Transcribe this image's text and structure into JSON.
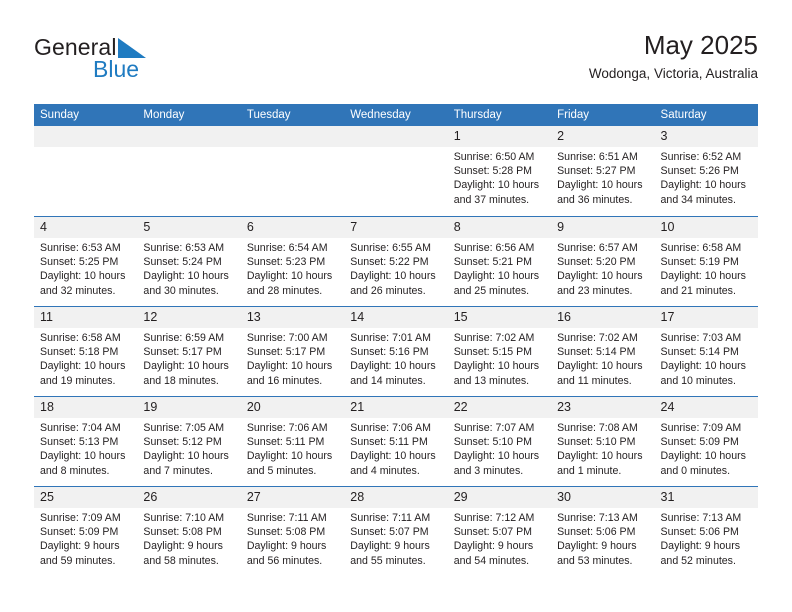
{
  "brand": {
    "name_part1": "General",
    "name_part2": "Blue",
    "triangle_color": "#1f7bc1"
  },
  "header": {
    "title": "May 2025",
    "subtitle": "Wodonga, Victoria, Australia"
  },
  "theme": {
    "header_blue": "#3075b8",
    "day_band_gray": "#f1f1f1",
    "text": "#231f20",
    "brand_blue": "#1f7bc1"
  },
  "weekdays": [
    "Sunday",
    "Monday",
    "Tuesday",
    "Wednesday",
    "Thursday",
    "Friday",
    "Saturday"
  ],
  "weeks": [
    [
      {
        "day": "",
        "lines": []
      },
      {
        "day": "",
        "lines": []
      },
      {
        "day": "",
        "lines": []
      },
      {
        "day": "",
        "lines": []
      },
      {
        "day": "1",
        "lines": [
          "Sunrise: 6:50 AM",
          "Sunset: 5:28 PM",
          "Daylight: 10 hours",
          "and 37 minutes."
        ]
      },
      {
        "day": "2",
        "lines": [
          "Sunrise: 6:51 AM",
          "Sunset: 5:27 PM",
          "Daylight: 10 hours",
          "and 36 minutes."
        ]
      },
      {
        "day": "3",
        "lines": [
          "Sunrise: 6:52 AM",
          "Sunset: 5:26 PM",
          "Daylight: 10 hours",
          "and 34 minutes."
        ]
      }
    ],
    [
      {
        "day": "4",
        "lines": [
          "Sunrise: 6:53 AM",
          "Sunset: 5:25 PM",
          "Daylight: 10 hours",
          "and 32 minutes."
        ]
      },
      {
        "day": "5",
        "lines": [
          "Sunrise: 6:53 AM",
          "Sunset: 5:24 PM",
          "Daylight: 10 hours",
          "and 30 minutes."
        ]
      },
      {
        "day": "6",
        "lines": [
          "Sunrise: 6:54 AM",
          "Sunset: 5:23 PM",
          "Daylight: 10 hours",
          "and 28 minutes."
        ]
      },
      {
        "day": "7",
        "lines": [
          "Sunrise: 6:55 AM",
          "Sunset: 5:22 PM",
          "Daylight: 10 hours",
          "and 26 minutes."
        ]
      },
      {
        "day": "8",
        "lines": [
          "Sunrise: 6:56 AM",
          "Sunset: 5:21 PM",
          "Daylight: 10 hours",
          "and 25 minutes."
        ]
      },
      {
        "day": "9",
        "lines": [
          "Sunrise: 6:57 AM",
          "Sunset: 5:20 PM",
          "Daylight: 10 hours",
          "and 23 minutes."
        ]
      },
      {
        "day": "10",
        "lines": [
          "Sunrise: 6:58 AM",
          "Sunset: 5:19 PM",
          "Daylight: 10 hours",
          "and 21 minutes."
        ]
      }
    ],
    [
      {
        "day": "11",
        "lines": [
          "Sunrise: 6:58 AM",
          "Sunset: 5:18 PM",
          "Daylight: 10 hours",
          "and 19 minutes."
        ]
      },
      {
        "day": "12",
        "lines": [
          "Sunrise: 6:59 AM",
          "Sunset: 5:17 PM",
          "Daylight: 10 hours",
          "and 18 minutes."
        ]
      },
      {
        "day": "13",
        "lines": [
          "Sunrise: 7:00 AM",
          "Sunset: 5:17 PM",
          "Daylight: 10 hours",
          "and 16 minutes."
        ]
      },
      {
        "day": "14",
        "lines": [
          "Sunrise: 7:01 AM",
          "Sunset: 5:16 PM",
          "Daylight: 10 hours",
          "and 14 minutes."
        ]
      },
      {
        "day": "15",
        "lines": [
          "Sunrise: 7:02 AM",
          "Sunset: 5:15 PM",
          "Daylight: 10 hours",
          "and 13 minutes."
        ]
      },
      {
        "day": "16",
        "lines": [
          "Sunrise: 7:02 AM",
          "Sunset: 5:14 PM",
          "Daylight: 10 hours",
          "and 11 minutes."
        ]
      },
      {
        "day": "17",
        "lines": [
          "Sunrise: 7:03 AM",
          "Sunset: 5:14 PM",
          "Daylight: 10 hours",
          "and 10 minutes."
        ]
      }
    ],
    [
      {
        "day": "18",
        "lines": [
          "Sunrise: 7:04 AM",
          "Sunset: 5:13 PM",
          "Daylight: 10 hours",
          "and 8 minutes."
        ]
      },
      {
        "day": "19",
        "lines": [
          "Sunrise: 7:05 AM",
          "Sunset: 5:12 PM",
          "Daylight: 10 hours",
          "and 7 minutes."
        ]
      },
      {
        "day": "20",
        "lines": [
          "Sunrise: 7:06 AM",
          "Sunset: 5:11 PM",
          "Daylight: 10 hours",
          "and 5 minutes."
        ]
      },
      {
        "day": "21",
        "lines": [
          "Sunrise: 7:06 AM",
          "Sunset: 5:11 PM",
          "Daylight: 10 hours",
          "and 4 minutes."
        ]
      },
      {
        "day": "22",
        "lines": [
          "Sunrise: 7:07 AM",
          "Sunset: 5:10 PM",
          "Daylight: 10 hours",
          "and 3 minutes."
        ]
      },
      {
        "day": "23",
        "lines": [
          "Sunrise: 7:08 AM",
          "Sunset: 5:10 PM",
          "Daylight: 10 hours",
          "and 1 minute."
        ]
      },
      {
        "day": "24",
        "lines": [
          "Sunrise: 7:09 AM",
          "Sunset: 5:09 PM",
          "Daylight: 10 hours",
          "and 0 minutes."
        ]
      }
    ],
    [
      {
        "day": "25",
        "lines": [
          "Sunrise: 7:09 AM",
          "Sunset: 5:09 PM",
          "Daylight: 9 hours",
          "and 59 minutes."
        ]
      },
      {
        "day": "26",
        "lines": [
          "Sunrise: 7:10 AM",
          "Sunset: 5:08 PM",
          "Daylight: 9 hours",
          "and 58 minutes."
        ]
      },
      {
        "day": "27",
        "lines": [
          "Sunrise: 7:11 AM",
          "Sunset: 5:08 PM",
          "Daylight: 9 hours",
          "and 56 minutes."
        ]
      },
      {
        "day": "28",
        "lines": [
          "Sunrise: 7:11 AM",
          "Sunset: 5:07 PM",
          "Daylight: 9 hours",
          "and 55 minutes."
        ]
      },
      {
        "day": "29",
        "lines": [
          "Sunrise: 7:12 AM",
          "Sunset: 5:07 PM",
          "Daylight: 9 hours",
          "and 54 minutes."
        ]
      },
      {
        "day": "30",
        "lines": [
          "Sunrise: 7:13 AM",
          "Sunset: 5:06 PM",
          "Daylight: 9 hours",
          "and 53 minutes."
        ]
      },
      {
        "day": "31",
        "lines": [
          "Sunrise: 7:13 AM",
          "Sunset: 5:06 PM",
          "Daylight: 9 hours",
          "and 52 minutes."
        ]
      }
    ]
  ]
}
